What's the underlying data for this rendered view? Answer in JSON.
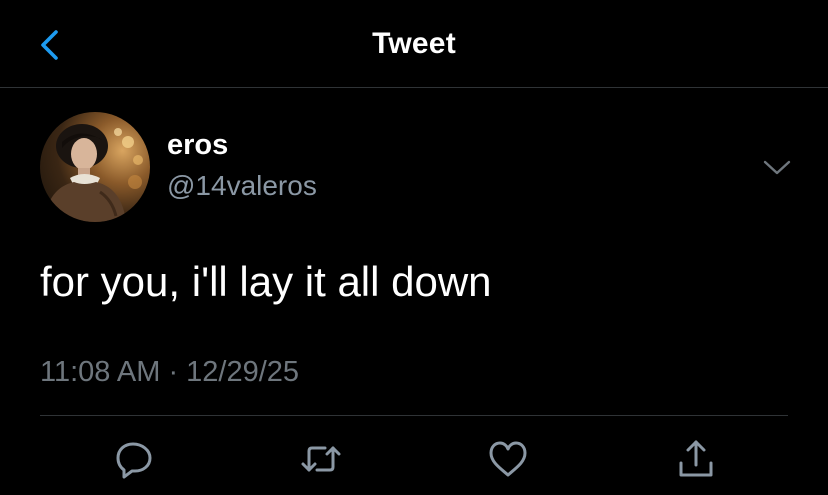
{
  "header": {
    "title": "Tweet",
    "back_icon": "chevron-left-icon"
  },
  "tweet": {
    "display_name": "eros",
    "handle": "@14valeros",
    "text": "for you, i'll lay it all down",
    "time": "11:08 AM",
    "separator": " · ",
    "date": "12/29/25",
    "more_icon": "chevron-down-icon"
  },
  "actions": [
    {
      "name": "reply",
      "icon": "reply-icon"
    },
    {
      "name": "retweet",
      "icon": "retweet-icon"
    },
    {
      "name": "like",
      "icon": "heart-icon"
    },
    {
      "name": "share",
      "icon": "share-icon"
    }
  ],
  "colors": {
    "background": "#000000",
    "accent": "#1d9bf0",
    "secondary_text": "#8b98a5",
    "meta_text": "#6e767d",
    "divider": "#2f3336",
    "icon": "#8b98a5"
  }
}
